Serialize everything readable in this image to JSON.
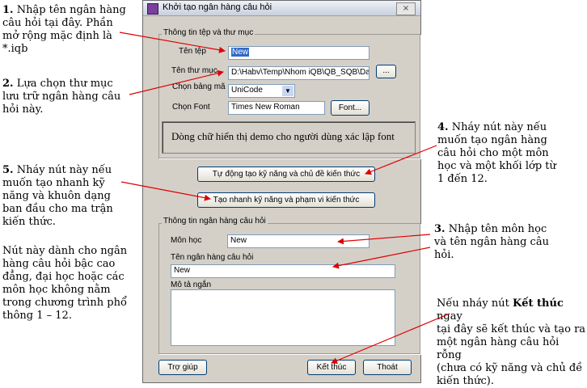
{
  "annotations": {
    "a1_num": "1.",
    "a1_lines": [
      "Nhập tên ngân hàng",
      "câu hỏi tại đây. Phần",
      "mở rộng mặc định là",
      "*.iqb"
    ],
    "a2_num": "2.",
    "a2_lines": [
      "Lựa chọn thư mục",
      "lưu trữ ngân hàng câu",
      "hỏi này."
    ],
    "a3_num": "3.",
    "a3_lines": [
      "Nhập tên môn học",
      "và tên ngân hàng câu",
      "hỏi."
    ],
    "a4_num": "4.",
    "a4_lines": [
      "Nháy nút này nếu",
      "muốn tạo ngân hàng",
      "câu hỏi cho một môn",
      "học và một khối lớp từ",
      "1 đến 12."
    ],
    "a5_num": "5.",
    "a5_lines": [
      "Nháy nút này nếu",
      "muốn tạo nhanh kỹ",
      "năng và khuôn dạng",
      "ban đầu cho ma trận",
      "kiến thức."
    ],
    "a5b_lines": [
      "Nút này dành cho ngân",
      "hàng câu hỏi bậc cao",
      "đẳng, đại học hoặc các",
      "môn học không nằm",
      "trong chương trình phổ",
      "thông 1 – 12."
    ],
    "a6_pre": "Nếu nháy nút ",
    "a6_bold": "Kết thúc",
    "a6_post": " ngay",
    "a6_lines": [
      "tại đây sẽ kết thúc và tạo ra",
      "một ngân hàng câu hỏi rỗng",
      "(chưa có kỹ năng và chủ đề",
      "kiến thức)."
    ]
  },
  "dialog": {
    "title": "Khởi tạo ngân hàng câu hỏi",
    "close_icon": "×",
    "group1_label": "Thông tin tệp và thư mục",
    "file_name_label": "Tên tệp",
    "file_name_value": "New",
    "folder_label": "Tên thư mục",
    "folder_value": "D:\\Habv\\Temp\\Nhom iQB\\QB_SQB\\Data\\",
    "browse_label": "...",
    "encoding_label": "Chọn bảng mã",
    "encoding_value": "UniCode",
    "font_label": "Chọn Font",
    "font_value": "Times New Roman",
    "font_button": "Font...",
    "font_demo": "Dòng chữ hiển thị demo cho người dùng xác lập font",
    "auto_button": "Tự động tạo kỹ năng và chủ đề kiến thức",
    "quick_button": "Tạo nhanh kỹ năng và phạm vi kiến thức",
    "group2_label": "Thông tin ngân hàng câu hỏi",
    "subject_label": "Môn học",
    "subject_value": "New",
    "bank_name_label": "Tên ngân hàng câu hỏi",
    "bank_name_value": "New",
    "description_label": "Mô tả ngắn",
    "description_value": "",
    "help_button": "Trợ giúp",
    "finish_button": "Kết thúc",
    "exit_button": "Thoát"
  }
}
